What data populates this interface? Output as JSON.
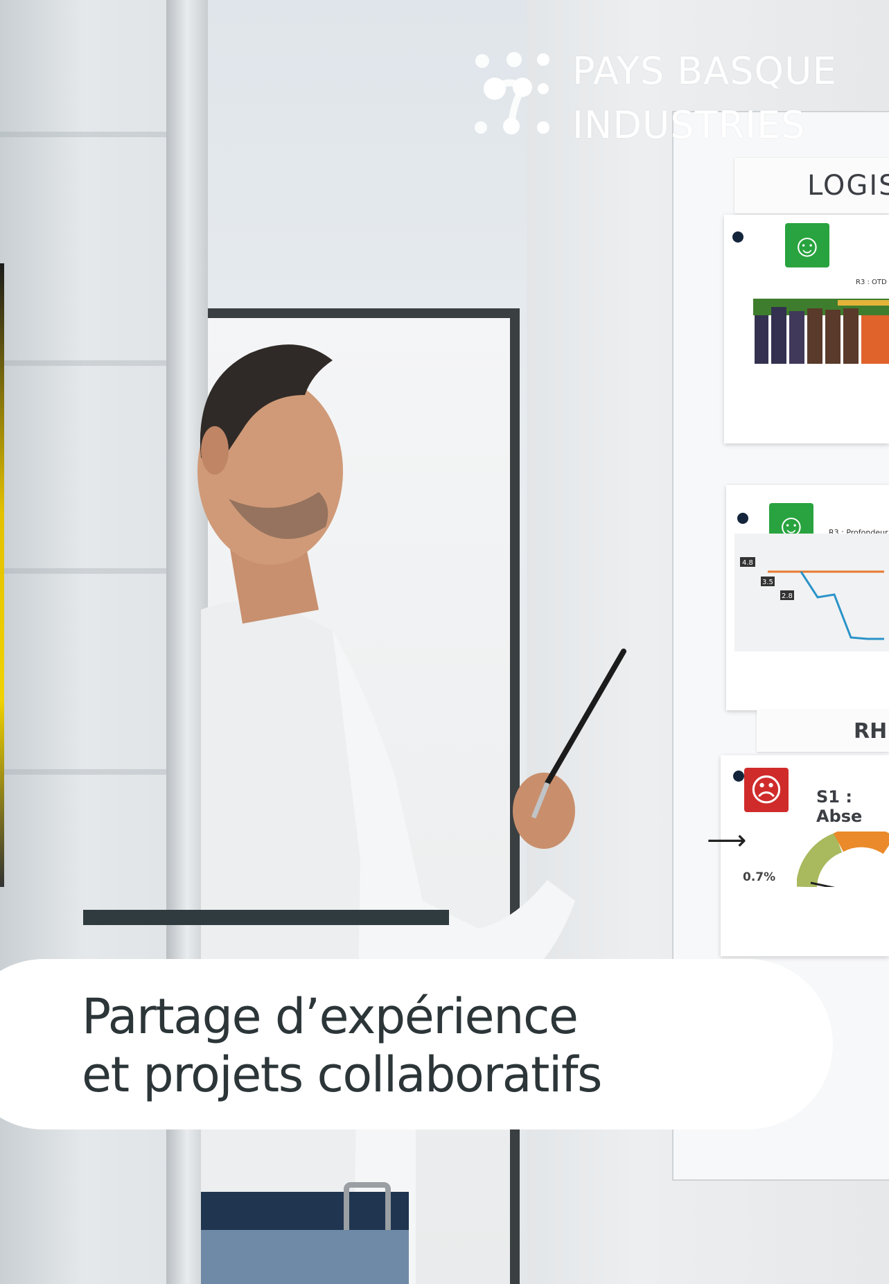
{
  "logo": {
    "name": "logo-mark",
    "line1": "PAYS BASQUE",
    "line2": "INDUSTRIES"
  },
  "board": {
    "title": "LOGIS",
    "section_label": "RH",
    "sheet1": {
      "chart_title": "R3 : OTD"
    },
    "sheet2": {
      "chart_title": "R3 : Profondeur",
      "labels": [
        "4.8",
        "3.5",
        "2.8"
      ]
    },
    "sheet3": {
      "title": "S1 : Abse",
      "value": "0.7%"
    }
  },
  "headline": {
    "line1": "Partage d’expérience",
    "line2": "et projets collaboratifs"
  },
  "colors": {
    "accent_bar": "#2f3b3f",
    "headline_text": "#2c3538",
    "good_face": "#29a33f",
    "bad_face": "#d02b2b"
  }
}
